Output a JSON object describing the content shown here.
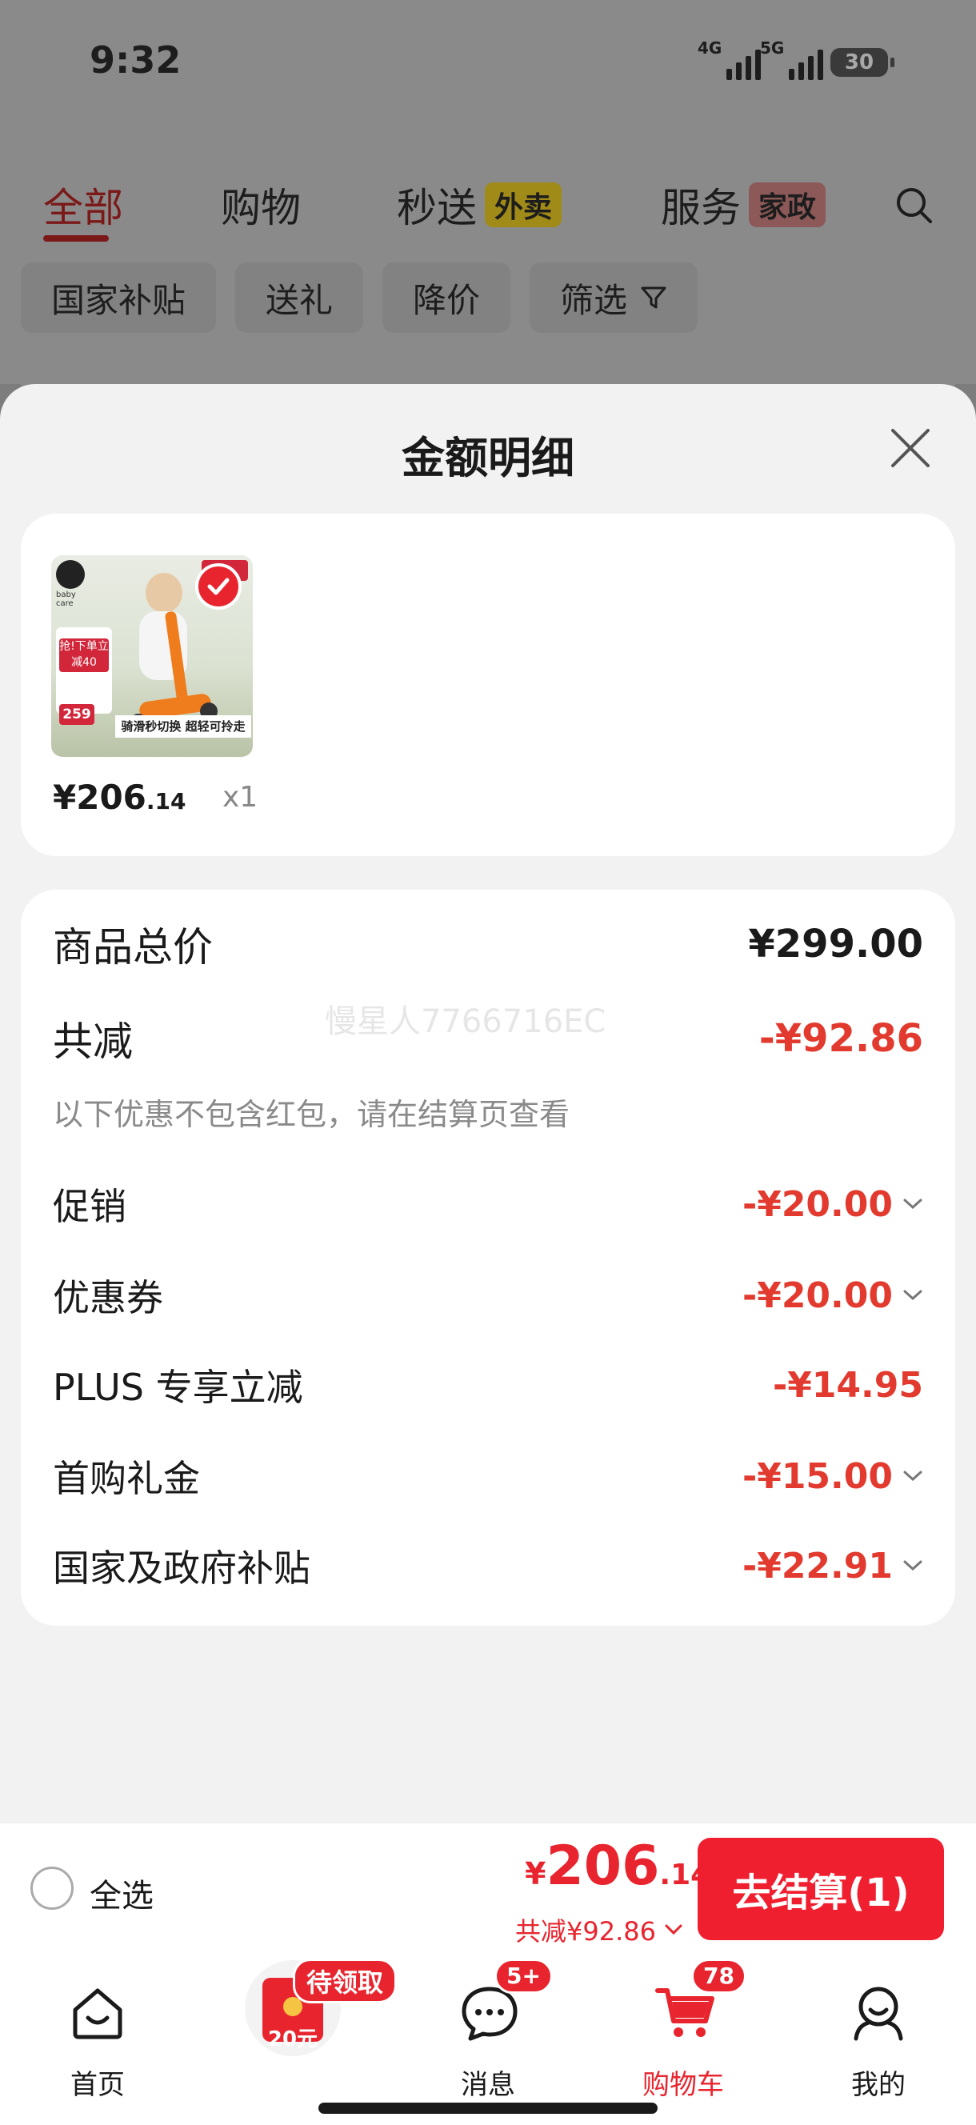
{
  "status": {
    "time": "9:32",
    "net1": "4G",
    "net2": "5G",
    "battery": "30"
  },
  "top_tabs": [
    {
      "label": "全部"
    },
    {
      "label": "购物"
    },
    {
      "label": "秒送",
      "badge": "外卖"
    },
    {
      "label": "服务",
      "badge": "家政"
    }
  ],
  "chips": [
    "国家补贴",
    "送礼",
    "降价",
    "筛选"
  ],
  "sheet": {
    "title": "金额明细",
    "product": {
      "price_int": "¥206",
      "price_dec": ".14",
      "qty": "x1",
      "thumb_caption": "骑滑秒切换 超轻可拎走",
      "thumb_promo": "抢!下单立减40",
      "thumb_price": "259"
    },
    "watermark": "慢星人7766716EC",
    "total_label": "商品总价",
    "total_value": "¥299.00",
    "discount_label": "共减",
    "discount_value": "-¥92.86",
    "note": "以下优惠不包含红包，请在结算页查看",
    "items": [
      {
        "label": "促销",
        "value": "-¥20.00",
        "expandable": true
      },
      {
        "label": "优惠券",
        "value": "-¥20.00",
        "expandable": true
      },
      {
        "label": "PLUS 专享立减",
        "value": "-¥14.95",
        "expandable": false
      },
      {
        "label": "首购礼金",
        "value": "-¥15.00",
        "expandable": true
      },
      {
        "label": "国家及政府补贴",
        "value": "-¥22.91",
        "expandable": true
      }
    ]
  },
  "checkout": {
    "select_all": "全选",
    "yen": "¥",
    "total_int": "206",
    "total_dec": ".14",
    "saved": "共减¥92.86",
    "button": "去结算(1)"
  },
  "nav": [
    {
      "label": "首页",
      "icon": "home-icon"
    },
    {
      "label": "",
      "icon": "red-packet-icon",
      "badge": "待领取",
      "packet_text": "20元"
    },
    {
      "label": "消息",
      "icon": "message-icon",
      "badge": "5+"
    },
    {
      "label": "购物车",
      "icon": "cart-icon",
      "badge": "78"
    },
    {
      "label": "我的",
      "icon": "profile-icon"
    }
  ],
  "colors": {
    "accent": "#e8252f",
    "discount": "#e23a2e"
  }
}
